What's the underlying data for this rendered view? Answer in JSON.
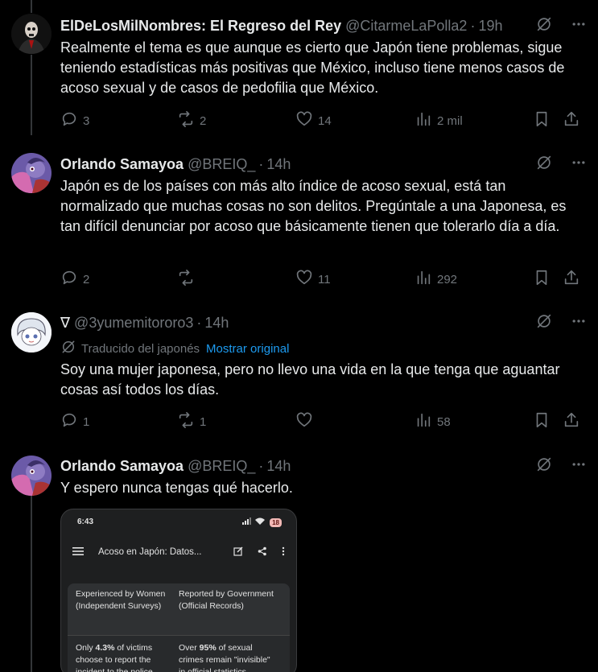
{
  "tweets": [
    {
      "name": "ElDeLosMilNombres: El Regreso del Rey",
      "handle": "@CitarmeLaPolla2",
      "dot": "·",
      "time": "19h",
      "text": "Realmente el tema es que aunque es cierto que Japón tiene problemas, sigue teniendo estadísticas más positivas que México, incluso tiene menos casos de acoso sexual y de casos de pedofilia que México.",
      "replies": "3",
      "retweets": "2",
      "likes": "14",
      "views": "2 mil"
    },
    {
      "name": "Orlando Samayoa",
      "handle": "@BREIQ_",
      "dot": "·",
      "time": "14h",
      "text": "Japón es de los países con más alto índice de acoso sexual, está tan normalizado que muchas cosas no son delitos. Pregúntale a una Japonesa, es tan difícil denunciar por acoso que básicamente tienen que tolerarlo día a día.",
      "replies": "2",
      "retweets": "",
      "likes": "11",
      "views": "292"
    },
    {
      "name": "∇",
      "handle": "@3yumemitororo3",
      "dot": "·",
      "time": "14h",
      "translated_label": "Traducido del japonés",
      "show_original": "Mostrar original",
      "text": "Soy una mujer japonesa, pero no llevo una vida en la que tenga que aguantar cosas así todos los días.",
      "replies": "1",
      "retweets": "1",
      "likes": "",
      "views": "58"
    },
    {
      "name": "Orlando Samayoa",
      "handle": "@BREIQ_",
      "dot": "·",
      "time": "14h",
      "text": "Y espero nunca tengas qué hacerlo.",
      "media": {
        "status_time": "6:43",
        "battery": "18",
        "title": "Acoso en Japón: Datos...",
        "col1_header": "Experienced by Women (Independent Surveys)",
        "col2_header": "Reported by Government (Official Records)",
        "row1_col1_a": "Only ",
        "row1_col1_b": "4.3%",
        "row1_col1_c": " of victims choose to report the incident to the police.",
        "row1_col2_a": "Over ",
        "row1_col2_b": "95%",
        "row1_col2_c": " of sexual crimes remain \"invisible\" in official statistics."
      }
    }
  ],
  "colors": {
    "background": "#000000",
    "text": "#e7e9ea",
    "muted": "#71767b",
    "link": "#1d9bf0"
  }
}
